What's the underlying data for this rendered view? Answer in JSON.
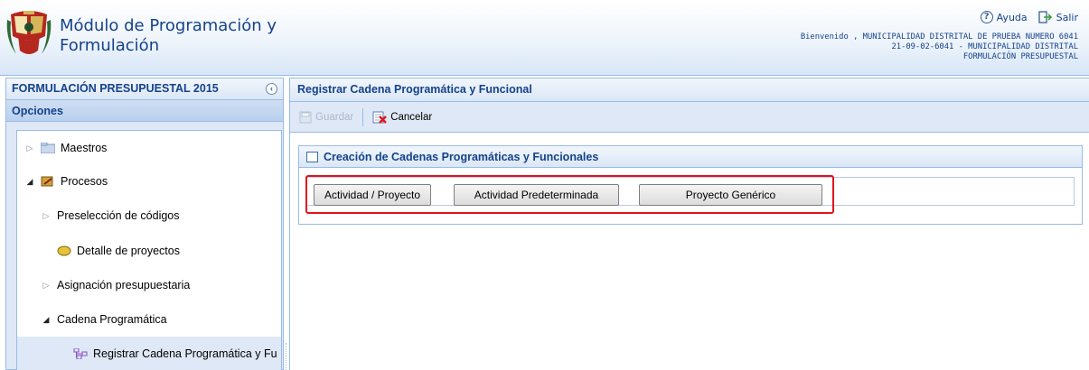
{
  "header": {
    "title_line1": "Módulo de Programación y",
    "title_line2": "Formulación",
    "help_label": "Ayuda",
    "exit_label": "Salir",
    "user_line1": "Bienvenido , MUNICIPALIDAD DISTRITAL DE PRUEBA NUMERO 6041",
    "user_line2": "21-09-02-6041 - MUNICIPALIDAD DISTRITAL",
    "user_line3": "FORMULACIÓN PRESUPUESTAL"
  },
  "sidebar": {
    "title": "FORMULACIÓN PRESUPUESTAL 2015",
    "options_label": "Opciones",
    "items": [
      {
        "label": "Maestros"
      },
      {
        "label": "Procesos"
      },
      {
        "label": "Preselección de códigos"
      },
      {
        "label": "Detalle de proyectos"
      },
      {
        "label": "Asignación presupuestaria"
      },
      {
        "label": "Cadena Programática"
      },
      {
        "label": "Registrar Cadena Programática y Fu"
      }
    ]
  },
  "main": {
    "title": "Registrar Cadena Programática y Funcional",
    "toolbar": {
      "save_label": "Guardar",
      "cancel_label": "Cancelar"
    },
    "section_title": "Creación de Cadenas Programáticas y Funcionales",
    "buttons": [
      {
        "label": "Actividad / Proyecto"
      },
      {
        "label": "Actividad Predeterminada"
      },
      {
        "label": "Proyecto Genérico"
      }
    ]
  },
  "colors": {
    "accent": "#15428b",
    "border": "#99bbe8",
    "panel_bg": "#dfe8f6",
    "highlight": "#e2141c"
  }
}
